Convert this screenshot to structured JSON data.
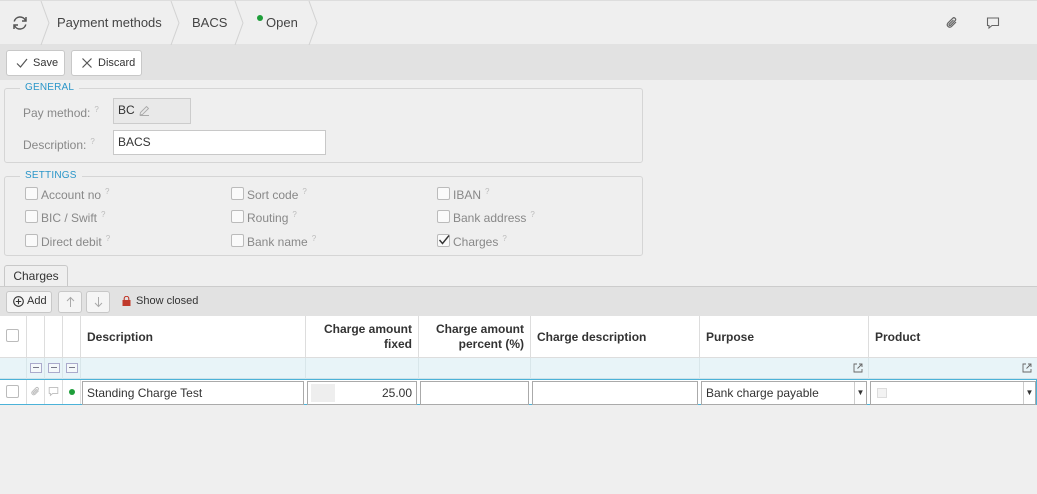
{
  "breadcrumb": {
    "items": [
      "Payment methods",
      "BACS"
    ],
    "status": "Open"
  },
  "toolbar": {
    "save_label": "Save",
    "discard_label": "Discard"
  },
  "general": {
    "legend": "GENERAL",
    "pay_method_label": "Pay method:",
    "pay_method_value": "BC",
    "description_label": "Description:",
    "description_value": "BACS"
  },
  "settings": {
    "legend": "SETTINGS",
    "options": [
      {
        "label": "Account no",
        "checked": false
      },
      {
        "label": "Sort code",
        "checked": false
      },
      {
        "label": "IBAN",
        "checked": false
      },
      {
        "label": "BIC / Swift",
        "checked": false
      },
      {
        "label": "Routing",
        "checked": false
      },
      {
        "label": "Bank address",
        "checked": false
      },
      {
        "label": "Direct debit",
        "checked": false
      },
      {
        "label": "Bank name",
        "checked": false
      },
      {
        "label": "Charges",
        "checked": true
      }
    ]
  },
  "charges_tab": {
    "label": "Charges",
    "add_label": "Add",
    "show_closed_label": "Show closed"
  },
  "grid": {
    "columns": {
      "description": "Description",
      "charge_fixed_1": "Charge amount",
      "charge_fixed_2": "fixed",
      "charge_percent_1": "Charge amount",
      "charge_percent_2": "percent (%)",
      "charge_description": "Charge description",
      "purpose": "Purpose",
      "product": "Product"
    },
    "rows": [
      {
        "description": "Standing Charge Test",
        "charge_fixed": "25.00",
        "charge_percent": "",
        "charge_description": "",
        "purpose": "Bank charge payable",
        "product": ""
      }
    ]
  },
  "colors": {
    "accent": "#2a96c9",
    "status_open": "#1e9e3a",
    "row_focus": "#4bb2d8"
  }
}
